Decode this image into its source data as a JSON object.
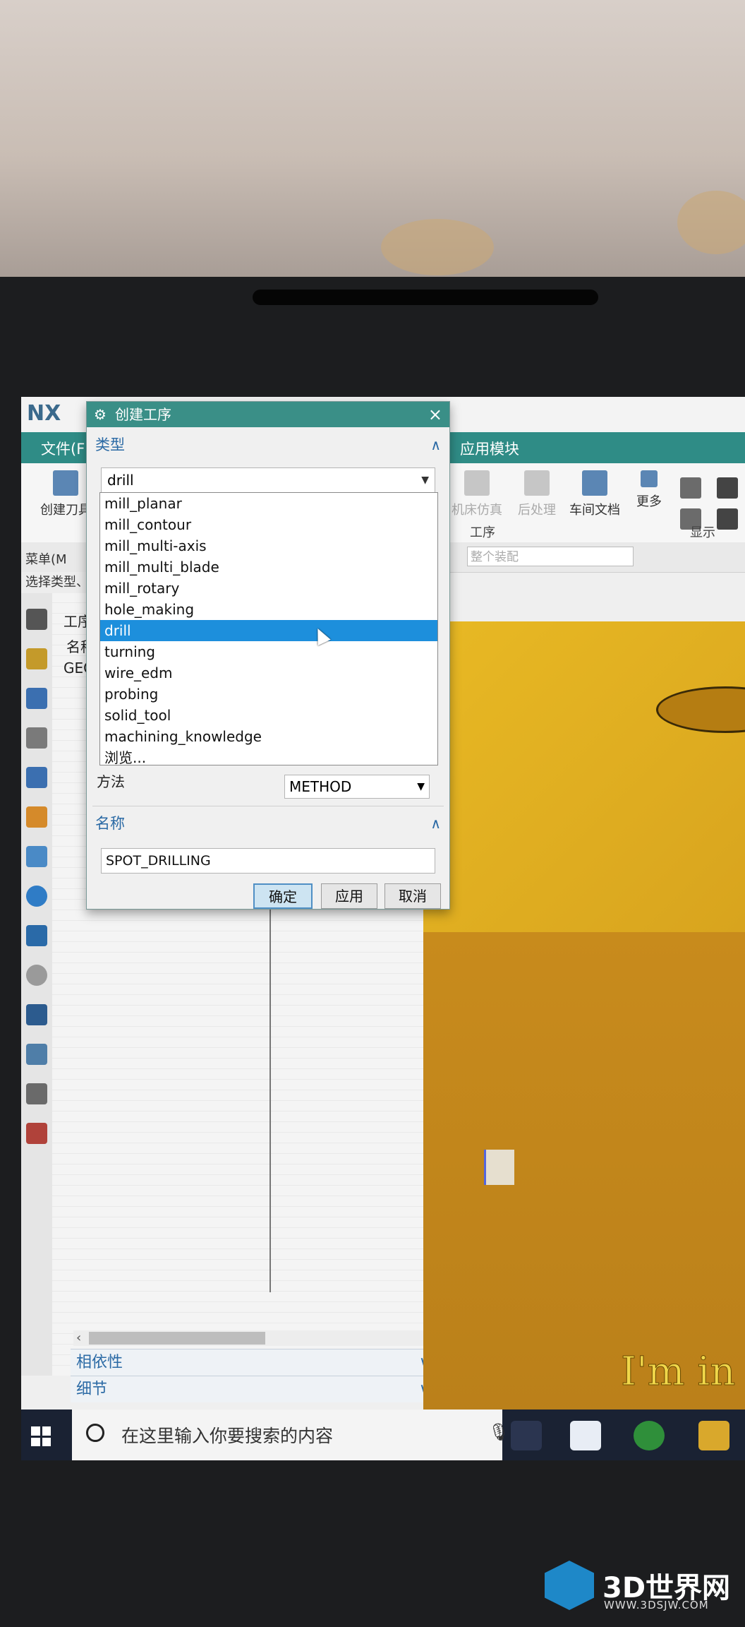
{
  "app": {
    "logo": "NX",
    "ribbon_tabs": [
      "文件(F",
      "应用模块"
    ],
    "ribbon_items": [
      "创建刀具",
      "机床仿真",
      "后处理",
      "车间文档",
      "更多"
    ],
    "ribbon_groups": [
      "工序",
      "显示"
    ],
    "menu_label": "菜单(M",
    "filter_combo": "整个装配",
    "subbar_text": "选择类型、",
    "nav_labels": {
      "tab": "工序",
      "col": "名称",
      "root": "GEO"
    },
    "nav_panels": [
      "相依性",
      "细节"
    ]
  },
  "dialog": {
    "title": "创建工序",
    "type_section": "类型",
    "type_selected": "drill",
    "type_options": [
      "mill_planar",
      "mill_contour",
      "mill_multi-axis",
      "mill_multi_blade",
      "mill_rotary",
      "hole_making",
      "drill",
      "turning",
      "wire_edm",
      "probing",
      "solid_tool",
      "machining_knowledge",
      "浏览..."
    ],
    "method_label": "方法",
    "method_value": "METHOD",
    "name_section": "名称",
    "name_value": "SPOT_DRILLING",
    "buttons": {
      "ok": "确定",
      "apply": "应用",
      "cancel": "取消"
    }
  },
  "viewport": {
    "overlay_text": "I'm in"
  },
  "taskbar": {
    "search_placeholder": "在这里输入你要搜索的内容"
  },
  "watermark": {
    "brand": "3D世界网",
    "url": "WWW.3DSJW.COM"
  },
  "colors": {
    "ribbon_teal": "#2f8c86",
    "dialog_title": "#3a8f87",
    "selection": "#1d8fdc",
    "model_yellow": "#e8b924"
  },
  "icons": [
    "settings-icon",
    "close-icon",
    "collapse-icon",
    "dropdown-arrow-icon",
    "windows-start-icon",
    "cortana-icon",
    "microphone-icon"
  ]
}
